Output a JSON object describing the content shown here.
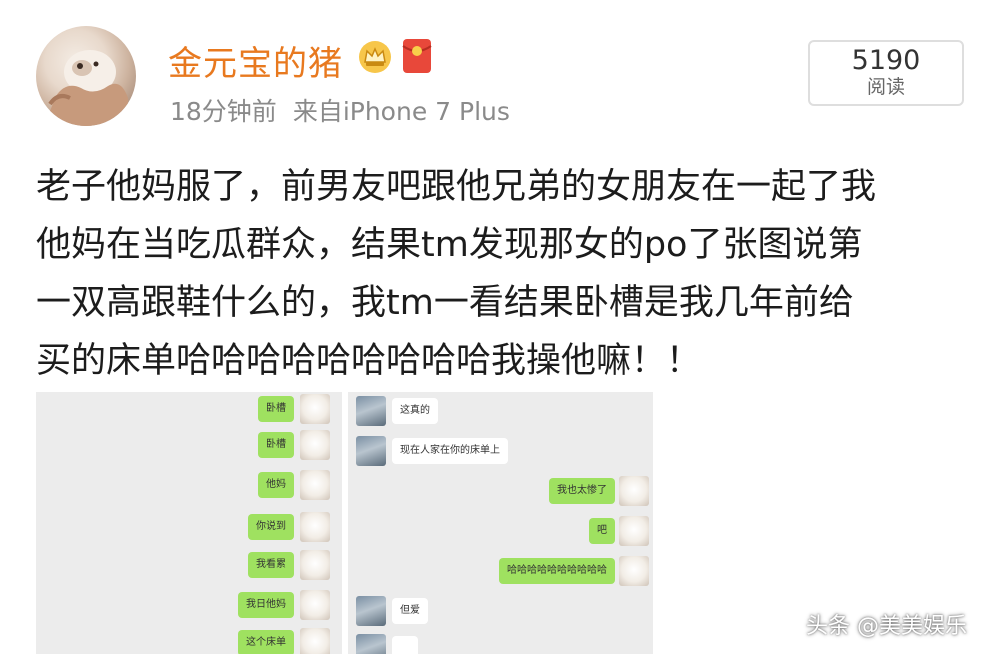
{
  "post": {
    "author": {
      "name": "金元宝的猪",
      "avatar_icon": "hamster-avatar",
      "badges": [
        "crown-badge-icon",
        "red-packet-icon"
      ]
    },
    "time": "18分钟前",
    "source": "来自iPhone 7 Plus",
    "read_count": "5190",
    "read_label": "阅读",
    "text_lines": [
      "老子他妈服了，前男友吧跟他兄弟的女朋友在一起了我",
      "他妈在当吃瓜群众，结果tm发现那女的po了张图说第",
      "一双高跟鞋什么的，我tm一看结果卧槽是我几年前给",
      "买的床单哈哈哈哈哈哈哈哈哈我操他嘛！！"
    ]
  },
  "chat_screenshot": {
    "left_pane": [
      {
        "text": "卧槽",
        "side": "right"
      },
      {
        "text": "卧槽",
        "side": "right"
      },
      {
        "text": "他妈",
        "side": "right"
      },
      {
        "text": "你说到",
        "side": "right"
      },
      {
        "text": "我看累",
        "side": "right"
      },
      {
        "text": "我日他妈",
        "side": "right"
      },
      {
        "text": "这个床单",
        "side": "right"
      }
    ],
    "right_pane": [
      {
        "text": "这真的",
        "side": "left"
      },
      {
        "text": "现在人家在你的床单上",
        "side": "left"
      },
      {
        "text": "我也太惨了",
        "side": "right"
      },
      {
        "text": "吧",
        "side": "right"
      },
      {
        "text": "哈哈哈哈哈哈哈哈哈哈",
        "side": "right"
      },
      {
        "text": "但爱",
        "side": "left"
      },
      {
        "text": "",
        "side": "left"
      }
    ]
  },
  "watermark": "头条 @美美娱乐",
  "colors": {
    "username": "#e8791f",
    "meta": "#8a8a8a",
    "bubble_green": "#9fe160",
    "bubble_white": "#ffffff"
  }
}
